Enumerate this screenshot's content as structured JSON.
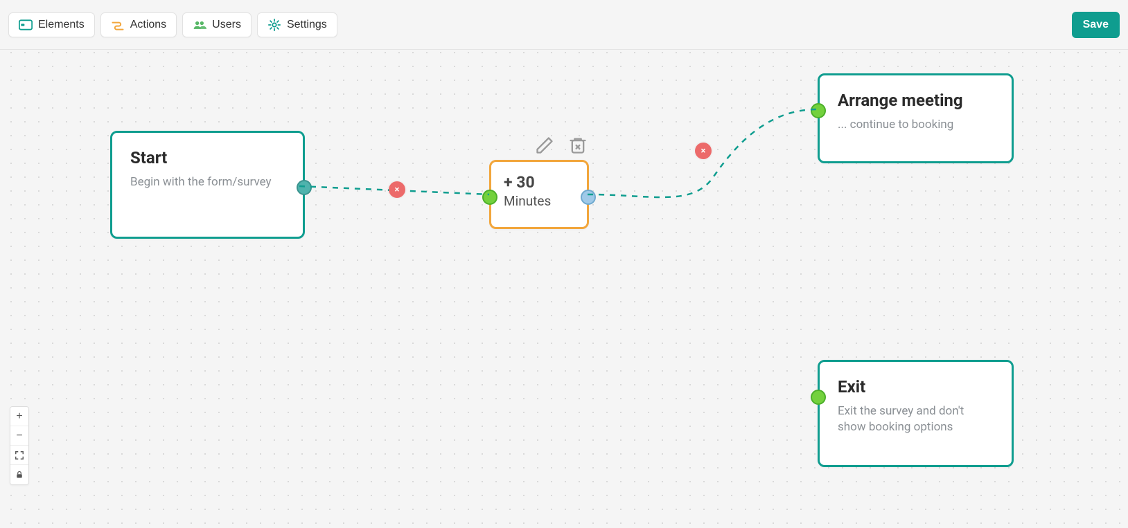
{
  "toolbar": {
    "elements_label": "Elements",
    "actions_label": "Actions",
    "users_label": "Users",
    "settings_label": "Settings",
    "save_label": "Save"
  },
  "nodes": {
    "start": {
      "title": "Start",
      "subtitle": "Begin with the form/survey"
    },
    "wait": {
      "title": "+ 30",
      "subtitle": "Minutes"
    },
    "meeting": {
      "title": "Arrange meeting",
      "subtitle": "... continue to booking"
    },
    "exit": {
      "title": "Exit",
      "subtitle": "Exit the survey and don't show booking options"
    }
  },
  "zoom": {
    "in": "+",
    "out": "−"
  },
  "edge_delete_glyph": "×"
}
